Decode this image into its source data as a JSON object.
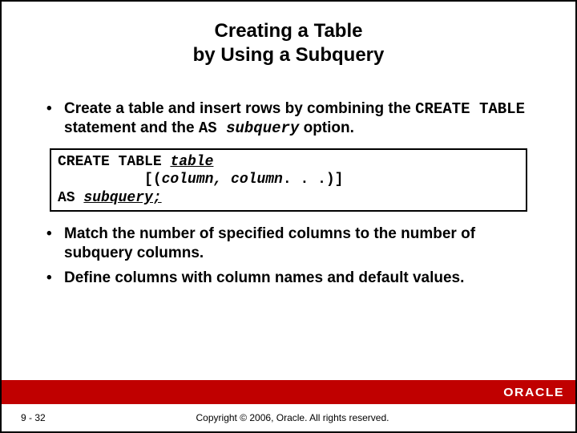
{
  "title": {
    "line1": "Creating a Table",
    "line2": "by Using a Subquery"
  },
  "bullet1": {
    "t1": "Create a table and insert rows by combining the ",
    "code1": "CREATE TABLE",
    "t2": " statement and the ",
    "code2": "AS ",
    "code3": "subquery",
    "t3": " option."
  },
  "code_box": {
    "l1a": "CREATE TABLE ",
    "l1b": "table",
    "l2a": "          [(",
    "l2b": "column, column",
    "l2c": ". . .)]",
    "l3a": "AS ",
    "l3b": "subquery;"
  },
  "bullet2": "Match the number of specified columns to the number of subquery columns.",
  "bullet3": "Define columns with column names and default values.",
  "footer": {
    "page": "9 - 32",
    "copyright": "Copyright © 2006, Oracle. All rights reserved.",
    "logo": "ORACLE"
  }
}
